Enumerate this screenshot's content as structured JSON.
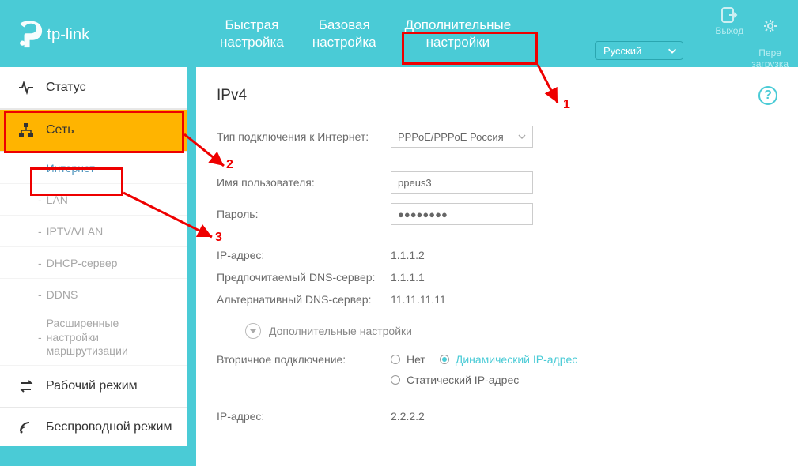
{
  "brand": "tp-link",
  "header": {
    "tabs": {
      "quick": "Быстрая\nнастройка",
      "basic": "Базовая\nнастройка",
      "advanced": "Дополнительные\nнастройки"
    },
    "logout": "Выход",
    "reboot": "Пере\nзагрузка",
    "language": "Русский"
  },
  "sidebar": {
    "status": "Статус",
    "network": "Сеть",
    "network_sub": {
      "internet": "Интернет",
      "lan": "LAN",
      "iptv": "IPTV/VLAN",
      "dhcp": "DHCP-сервер",
      "ddns": "DDNS",
      "routing": "Расширенные настройки маршрутизации"
    },
    "opmode": "Рабочий режим",
    "wireless": "Беспроводной режим"
  },
  "content": {
    "section": "IPv4",
    "conn_type_label": "Тип подключения к Интернет:",
    "conn_type_value": "PPPoE/PPPoE Россия",
    "username_label": "Имя пользователя:",
    "username_value": "ppeus3",
    "password_label": "Пароль:",
    "password_value": "●●●●●●●●",
    "ip_label": "IP-адрес:",
    "ip_value": "1.1.1.2",
    "dns1_label": "Предпочитаемый DNS-сервер:",
    "dns1_value": "1.1.1.1",
    "dns2_label": "Альтернативный DNS-сервер:",
    "dns2_value": "11.11.11.11",
    "adv_toggle": "Дополнительные настройки",
    "sec_conn_label": "Вторичное подключение:",
    "radio_none": "Нет",
    "radio_dyn": "Динамический IP-адрес",
    "radio_stat": "Статический IP-адрес",
    "ip2_label": "IP-адрес:",
    "ip2_value": "2.2.2.2"
  },
  "annotations": {
    "n1": "1",
    "n2": "2",
    "n3": "3"
  }
}
